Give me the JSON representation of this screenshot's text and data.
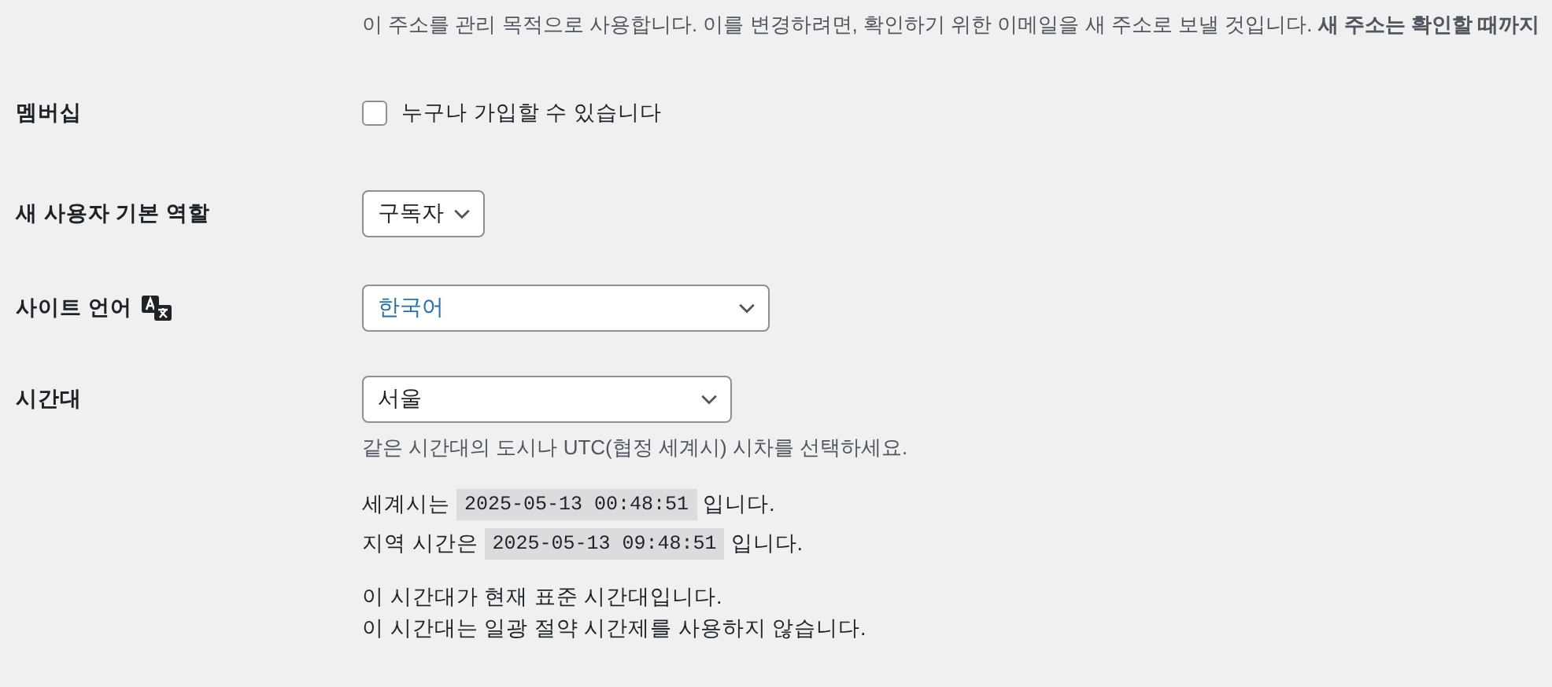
{
  "email_description": "이 주소를 관리 목적으로 사용합니다. 이를 변경하려면, 확인하기 위한 이메일을 새 주소로 보낼 것입니다. **새 주소는 확인할 때까지**",
  "membership": {
    "label": "멤버십",
    "checkbox_label": "누구나 가입할 수 있습니다",
    "checked": false
  },
  "default_role": {
    "label": "새 사용자 기본 역할",
    "value": "구독자"
  },
  "site_language": {
    "label": "사이트 언어",
    "value": "한국어"
  },
  "timezone": {
    "label": "시간대",
    "value": "서울",
    "description": "같은 시간대의 도시나 UTC(협정 세계시) 시차를 선택하세요.",
    "utc": {
      "prefix": "세계시는",
      "time": "2025-05-13 00:48:51",
      "suffix": "입니다."
    },
    "local": {
      "prefix": "지역 시간은",
      "time": "2025-05-13 09:48:51",
      "suffix": "입니다."
    },
    "notes": [
      "이 시간대가 현재 표준 시간대입니다.",
      "이 시간대는 일광 절약 시간제를 사용하지 않습니다."
    ]
  }
}
